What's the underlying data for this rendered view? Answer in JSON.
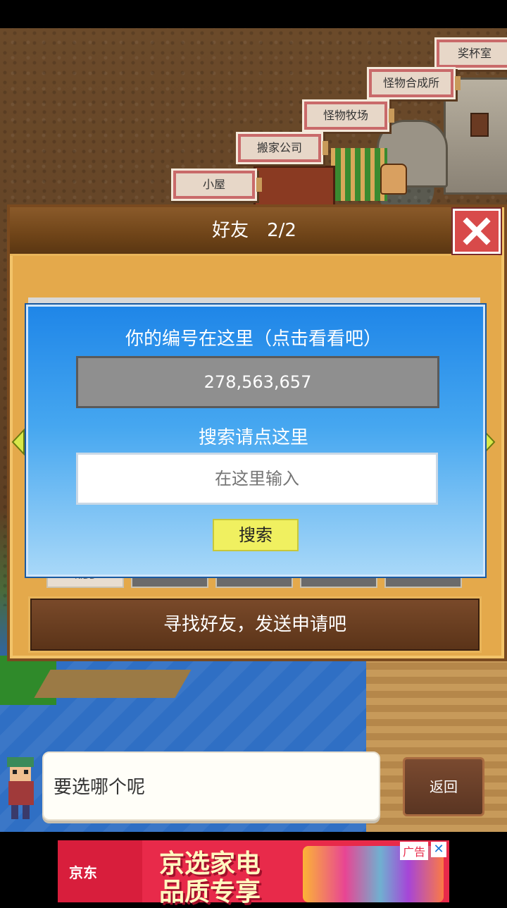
{
  "buildings": {
    "trophy_room": "奖杯室",
    "monster_fusion": "怪物合成所",
    "monster_ranch": "怪物牧场",
    "moving_company": "搬家公司",
    "hut": "小屋"
  },
  "dialog": {
    "title": "好友　2/2",
    "close_icon": "close-icon"
  },
  "panel": {
    "id_prompt": "你的编号在这里（点击看看吧）",
    "player_id": "278,563,657",
    "search_prompt": "搜索请点这里",
    "search_placeholder": "在这里输入",
    "search_button": "搜索"
  },
  "slot_first_text": "KIDD",
  "find_friend_button": "寻找好友，发送申请吧",
  "speech": {
    "text": "要选哪个呢"
  },
  "back_button": "返回",
  "ad": {
    "brand": "京东",
    "headline_line1": "京选家电",
    "headline_line2": "品质专享",
    "badge": "广告",
    "close": "✕"
  },
  "colors": {
    "panel_blue": "#1f86e8",
    "search_button_yellow": "#f0f060",
    "close_red": "#d84a4a",
    "frame_orange": "#e4a94b"
  }
}
